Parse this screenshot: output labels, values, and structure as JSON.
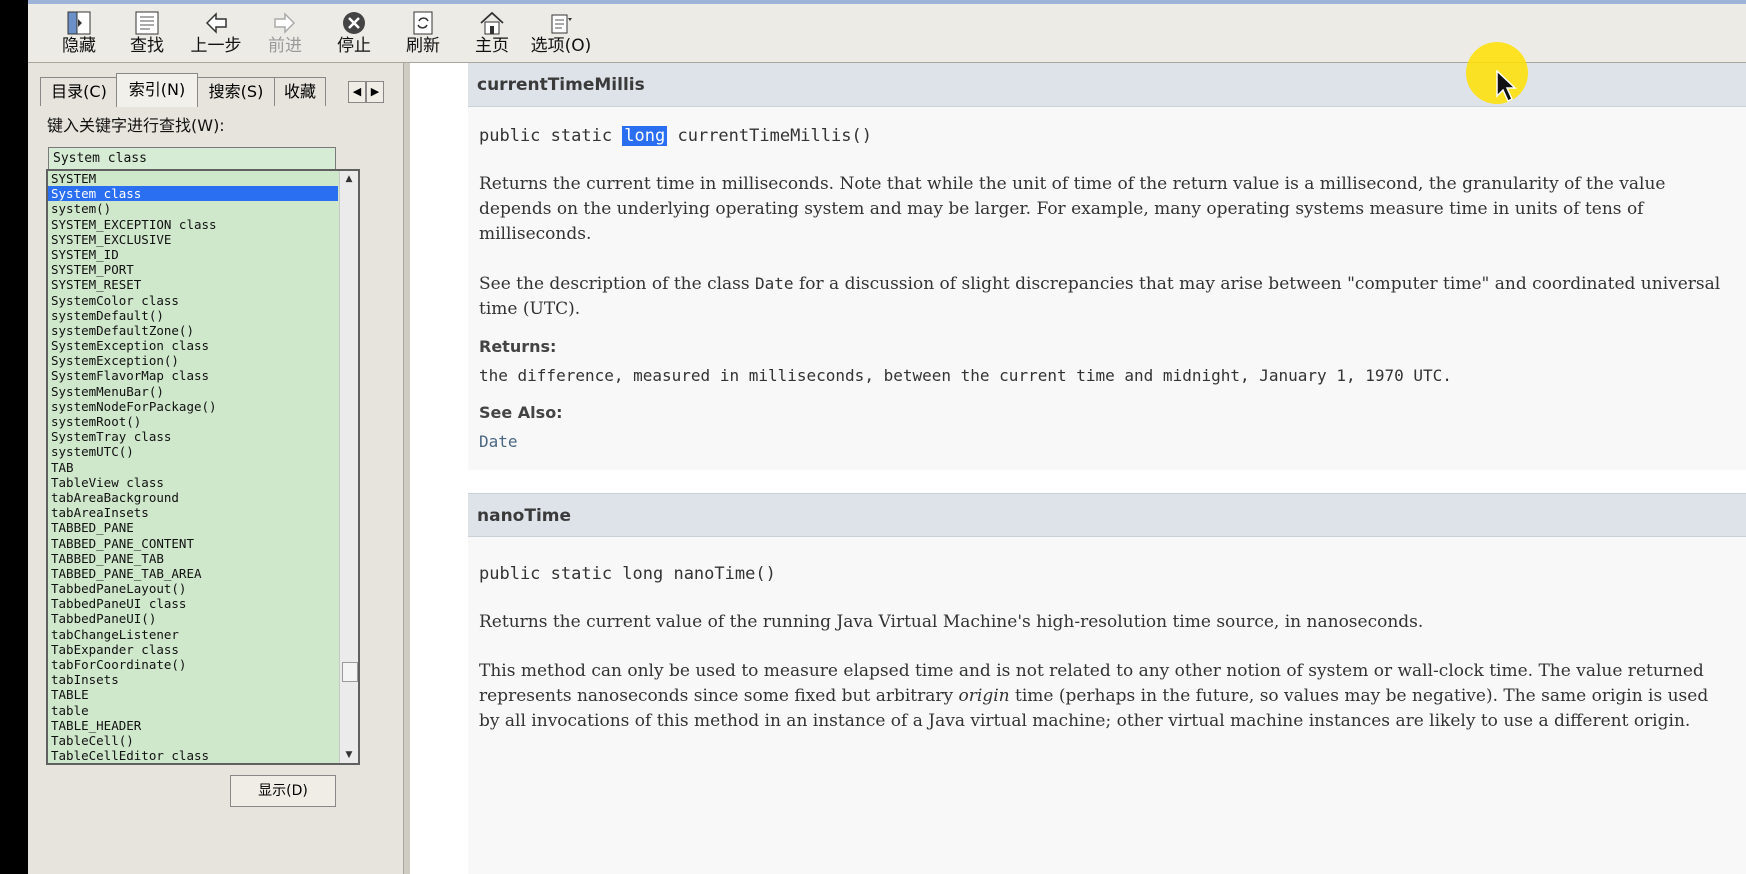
{
  "toolbar": {
    "buttons": [
      {
        "label": "隐藏",
        "icon": "hide-icon"
      },
      {
        "label": "查找",
        "icon": "find-icon"
      },
      {
        "label": "上一步",
        "icon": "back-arrow-icon"
      },
      {
        "label": "前进",
        "icon": "forward-arrow-icon",
        "disabled": true
      },
      {
        "label": "停止",
        "icon": "stop-icon"
      },
      {
        "label": "刷新",
        "icon": "refresh-icon"
      },
      {
        "label": "主页",
        "icon": "home-icon"
      },
      {
        "label": "选项(O)",
        "icon": "options-icon"
      }
    ]
  },
  "sidebar": {
    "tabs": [
      "目录(C)",
      "索引(N)",
      "搜索(S)",
      "收藏"
    ],
    "active_tab": "索引(N)",
    "keyword_label": "键入关键字进行查找(W):",
    "keyword_value": "System class",
    "index_items": [
      "SYSTEM",
      "System class",
      "system()",
      "SYSTEM_EXCEPTION class",
      "SYSTEM_EXCLUSIVE",
      "SYSTEM_ID",
      "SYSTEM_PORT",
      "SYSTEM_RESET",
      "SystemColor class",
      "systemDefault()",
      "systemDefaultZone()",
      "SystemException class",
      "SystemException()",
      "SystemFlavorMap class",
      "SystemMenuBar()",
      "systemNodeForPackage()",
      "systemRoot()",
      "SystemTray class",
      "systemUTC()",
      "TAB",
      "TableView class",
      "tabAreaBackground",
      "tabAreaInsets",
      "TABBED_PANE",
      "TABBED_PANE_CONTENT",
      "TABBED_PANE_TAB",
      "TABBED_PANE_TAB_AREA",
      "TabbedPaneLayout()",
      "TabbedPaneUI class",
      "TabbedPaneUI()",
      "tabChangeListener",
      "TabExpander class",
      "tabForCoordinate()",
      "tabInsets",
      "TABLE",
      "table",
      "TABLE_HEADER",
      "TableCell()",
      "TableCellEditor class"
    ],
    "selected_index": 1,
    "show_button": "显示(D)"
  },
  "content": {
    "method1": {
      "name": "currentTimeMillis",
      "sig_prefix": "public static ",
      "sig_highlight": "long",
      "sig_suffix": " currentTimeMillis()",
      "desc": "Returns the current time in milliseconds. Note that while the unit of time of the return value is a millisecond, the granularity of the value depends on the underlying operating system and may be larger. For example, many operating systems measure time in units of tens of milliseconds.",
      "see_desc_1": "See the description of the class ",
      "see_desc_code": "Date",
      "see_desc_2": " for a discussion of slight discrepancies that may arise between \"computer time\" and coordinated universal time (UTC).",
      "returns_label": "Returns:",
      "returns_value": "the difference, measured in milliseconds, between the current time and midnight, January 1, 1970 UTC.",
      "see_also_label": "See Also:",
      "see_also_link": "Date"
    },
    "method2": {
      "name": "nanoTime",
      "signature": "public static long nanoTime()",
      "desc": "Returns the current value of the running Java Virtual Machine's high-resolution time source, in nanoseconds.",
      "desc2_a": "This method can only be used to measure elapsed time and is not related to any other notion of system or wall-clock time. The value returned represents nanoseconds since some fixed but arbitrary ",
      "desc2_em": "origin",
      "desc2_b": " time (perhaps in the future, so values may be negative). The same origin is used by all invocations of this method in an instance of a Java virtual machine; other virtual machine instances are likely to use a different origin."
    }
  },
  "colors": {
    "selection": "#2a6ff1",
    "list_bg": "#cfe8cc",
    "header_bg": "#dee3e9",
    "link": "#4a6782",
    "cursor_highlight": "#ffe100"
  }
}
